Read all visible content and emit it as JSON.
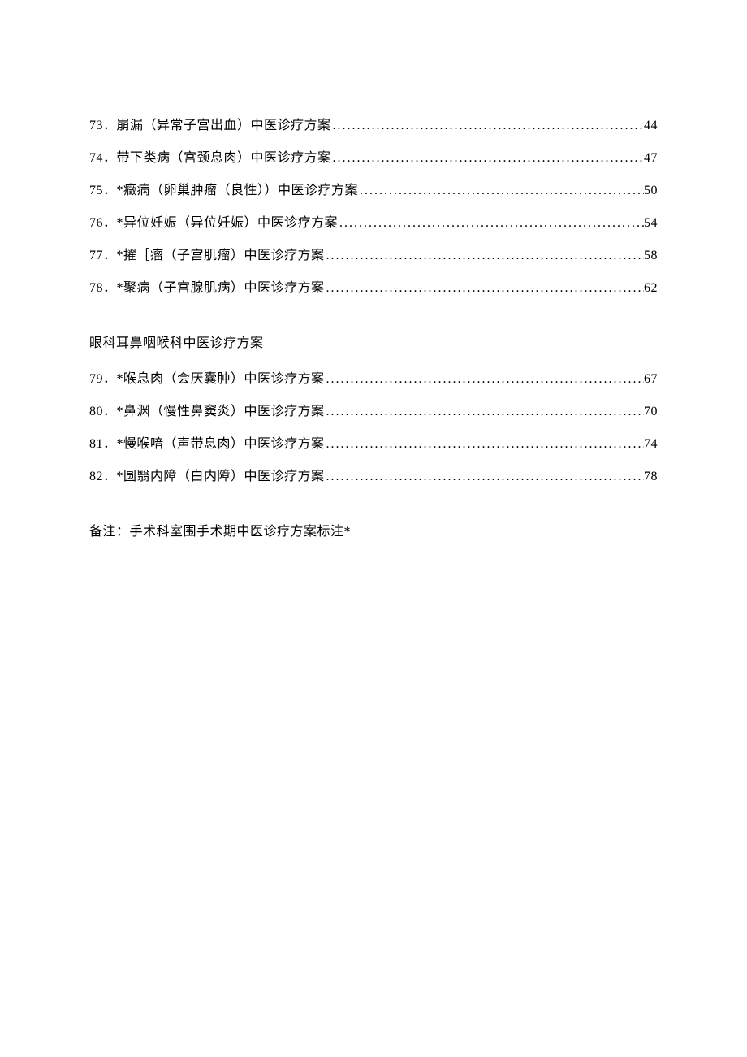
{
  "toc_group_1": [
    {
      "number": "73",
      "sep": "．",
      "title": "崩漏（异常子宫出血）中医诊疗方案",
      "page": "44"
    },
    {
      "number": "74",
      "sep": "．",
      "title": "带下类病（宫颈息肉）中医诊疗方案",
      "page": "47"
    },
    {
      "number": "75",
      "sep": "．",
      "title": "*癥病（卵巢肿瘤（良性））中医诊疗方案",
      "page": "50"
    },
    {
      "number": "76",
      "sep": "．",
      "title": "*异位妊娠（异位妊娠）中医诊疗方案",
      "page": "54"
    },
    {
      "number": "77",
      "sep": "．",
      "title": "*擢［瘤（子宫肌瘤）中医诊疗方案",
      "page": "58"
    },
    {
      "number": "78",
      "sep": "．",
      "title": "*聚病（子宫腺肌病）中医诊疗方案",
      "page": "62"
    }
  ],
  "section_heading_2": "眼科耳鼻咽喉科中医诊疗方案",
  "toc_group_2": [
    {
      "number": "79",
      "sep": "．",
      "title": "*喉息肉（会厌囊肿）中医诊疗方案",
      "page": "67"
    },
    {
      "number": "80",
      "sep": "．",
      "title": "*鼻渊（慢性鼻窦炎）中医诊疗方案",
      "page": "70"
    },
    {
      "number": "81",
      "sep": "．",
      "title": "*慢喉喑（声带息肉）中医诊疗方案",
      "page": "74"
    },
    {
      "number": "82",
      "sep": "．",
      "title": "*圆翳内障（白内障）中医诊疗方案",
      "page": "78"
    }
  ],
  "footnote": "备注：手术科室围手术期中医诊疗方案标注*",
  "dots": "............................................................................................"
}
